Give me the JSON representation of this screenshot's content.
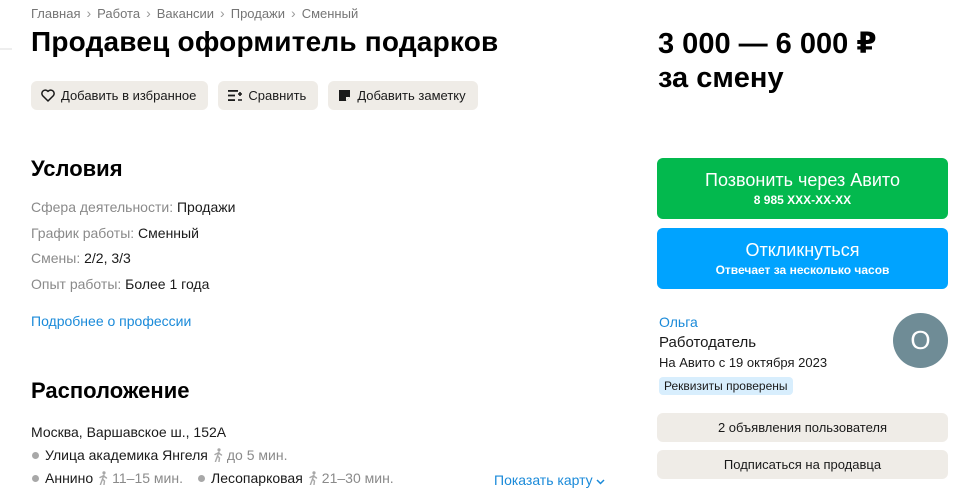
{
  "breadcrumb": [
    "Главная",
    "Работа",
    "Вакансии",
    "Продажи",
    "Сменный"
  ],
  "title": "Продавец оформитель подарков",
  "actions": {
    "favorite": "Добавить в избранное",
    "compare": "Сравнить",
    "note": "Добавить заметку"
  },
  "conditions": {
    "heading": "Условия",
    "rows": [
      {
        "key": "Сфера деятельности:",
        "value": "Продажи"
      },
      {
        "key": "График работы:",
        "value": "Сменный"
      },
      {
        "key": "Смены:",
        "value": "2/2, 3/3"
      },
      {
        "key": "Опыт работы:",
        "value": "Более 1 года"
      }
    ],
    "more_link": "Подробнее о профессии"
  },
  "location": {
    "heading": "Расположение",
    "address": "Москва, Варшавское ш., 152А",
    "metro": [
      {
        "name": "Улица академика Янгеля",
        "time": "до 5 мин."
      },
      {
        "name": "Аннино",
        "time": "11–15 мин."
      },
      {
        "name": "Лесопарковая",
        "time": "21–30 мин."
      }
    ],
    "show_map": "Показать карту"
  },
  "price": {
    "amount": "3 000 — 6 000 ₽",
    "period": "за смену"
  },
  "contact": {
    "call_label": "Позвонить через Авито",
    "phone": "8 985 XXX-XX-XX",
    "reply_label": "Откликнуться",
    "reply_sub": "Отвечает за несколько часов"
  },
  "seller": {
    "name": "Ольга",
    "role": "Работодатель",
    "since": "На Авито с 19 октября 2023",
    "badge": "Реквизиты проверены",
    "avatar_letter": "О",
    "listings": "2 объявления пользователя",
    "subscribe": "Подписаться на продавца"
  },
  "colors": {
    "call": "#03b94e",
    "reply": "#00a3ff",
    "link": "#1a8ad9",
    "chip": "#efece7",
    "avatar": "#6f8c96"
  }
}
